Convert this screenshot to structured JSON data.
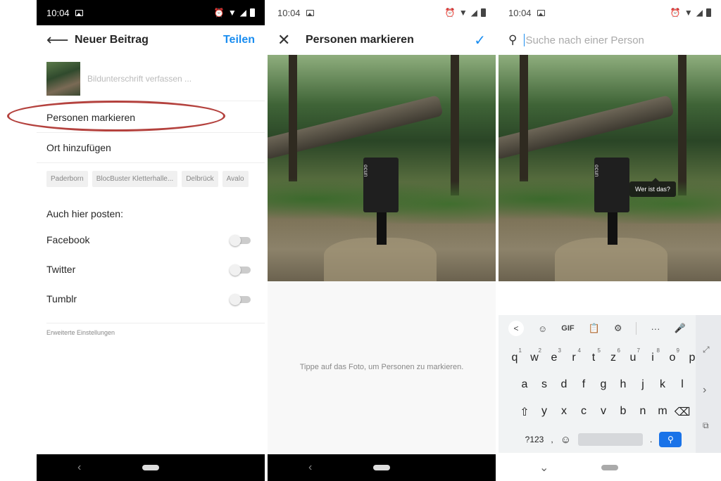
{
  "panel1": {
    "status": {
      "time": "10:04"
    },
    "header": {
      "title": "Neuer Beitrag",
      "share": "Teilen"
    },
    "caption_placeholder": "Bildunterschrift verfassen ...",
    "tag_people": "Personen markieren",
    "add_location": "Ort hinzufügen",
    "location_chips": [
      "Paderborn",
      "BlocBuster Kletterhalle...",
      "Delbrück",
      "Avalo"
    ],
    "also_post": "Auch hier posten:",
    "share_targets": [
      "Facebook",
      "Twitter",
      "Tumblr"
    ],
    "advanced": "Erweiterte Einstellungen",
    "highlight_color": "#b4423e"
  },
  "panel2": {
    "status": {
      "time": "10:04"
    },
    "header": {
      "title": "Personen markieren"
    },
    "photo_text": "ocun",
    "hint": "Tippe auf das Foto, um Personen zu markieren."
  },
  "panel3": {
    "status": {
      "time": "10:04"
    },
    "search_placeholder": "Suche nach einer Person",
    "photo_text": "ocun",
    "tooltip": "Wer ist das?",
    "keyboard": {
      "tools": [
        "<",
        "☺",
        "GIF",
        "📋",
        "⚙",
        "···",
        "🎤"
      ],
      "row1": [
        "q",
        "w",
        "e",
        "r",
        "t",
        "z",
        "u",
        "i",
        "o",
        "p"
      ],
      "row1_digits": [
        "1",
        "2",
        "3",
        "4",
        "5",
        "6",
        "7",
        "8",
        "9",
        "0"
      ],
      "row2": [
        "a",
        "s",
        "d",
        "f",
        "g",
        "h",
        "j",
        "k",
        "l"
      ],
      "row3": [
        "⇧",
        "y",
        "x",
        "c",
        "v",
        "b",
        "n",
        "m",
        "⌫"
      ],
      "bottom": {
        "sym": "?123",
        "comma": ",",
        "emoji": "☺",
        "period": "."
      }
    }
  },
  "colors": {
    "accent": "#1a8df0"
  }
}
